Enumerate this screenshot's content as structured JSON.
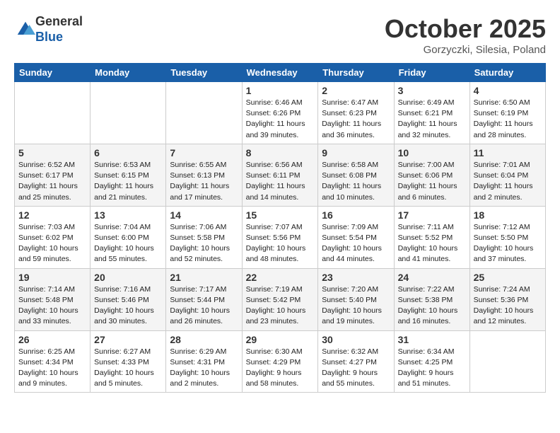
{
  "header": {
    "logo_line1": "General",
    "logo_line2": "Blue",
    "month_title": "October 2025",
    "location": "Gorzyczki, Silesia, Poland"
  },
  "days_of_week": [
    "Sunday",
    "Monday",
    "Tuesday",
    "Wednesday",
    "Thursday",
    "Friday",
    "Saturday"
  ],
  "weeks": [
    [
      {
        "day": "",
        "info": ""
      },
      {
        "day": "",
        "info": ""
      },
      {
        "day": "",
        "info": ""
      },
      {
        "day": "1",
        "info": "Sunrise: 6:46 AM\nSunset: 6:26 PM\nDaylight: 11 hours\nand 39 minutes."
      },
      {
        "day": "2",
        "info": "Sunrise: 6:47 AM\nSunset: 6:23 PM\nDaylight: 11 hours\nand 36 minutes."
      },
      {
        "day": "3",
        "info": "Sunrise: 6:49 AM\nSunset: 6:21 PM\nDaylight: 11 hours\nand 32 minutes."
      },
      {
        "day": "4",
        "info": "Sunrise: 6:50 AM\nSunset: 6:19 PM\nDaylight: 11 hours\nand 28 minutes."
      }
    ],
    [
      {
        "day": "5",
        "info": "Sunrise: 6:52 AM\nSunset: 6:17 PM\nDaylight: 11 hours\nand 25 minutes."
      },
      {
        "day": "6",
        "info": "Sunrise: 6:53 AM\nSunset: 6:15 PM\nDaylight: 11 hours\nand 21 minutes."
      },
      {
        "day": "7",
        "info": "Sunrise: 6:55 AM\nSunset: 6:13 PM\nDaylight: 11 hours\nand 17 minutes."
      },
      {
        "day": "8",
        "info": "Sunrise: 6:56 AM\nSunset: 6:11 PM\nDaylight: 11 hours\nand 14 minutes."
      },
      {
        "day": "9",
        "info": "Sunrise: 6:58 AM\nSunset: 6:08 PM\nDaylight: 11 hours\nand 10 minutes."
      },
      {
        "day": "10",
        "info": "Sunrise: 7:00 AM\nSunset: 6:06 PM\nDaylight: 11 hours\nand 6 minutes."
      },
      {
        "day": "11",
        "info": "Sunrise: 7:01 AM\nSunset: 6:04 PM\nDaylight: 11 hours\nand 2 minutes."
      }
    ],
    [
      {
        "day": "12",
        "info": "Sunrise: 7:03 AM\nSunset: 6:02 PM\nDaylight: 10 hours\nand 59 minutes."
      },
      {
        "day": "13",
        "info": "Sunrise: 7:04 AM\nSunset: 6:00 PM\nDaylight: 10 hours\nand 55 minutes."
      },
      {
        "day": "14",
        "info": "Sunrise: 7:06 AM\nSunset: 5:58 PM\nDaylight: 10 hours\nand 52 minutes."
      },
      {
        "day": "15",
        "info": "Sunrise: 7:07 AM\nSunset: 5:56 PM\nDaylight: 10 hours\nand 48 minutes."
      },
      {
        "day": "16",
        "info": "Sunrise: 7:09 AM\nSunset: 5:54 PM\nDaylight: 10 hours\nand 44 minutes."
      },
      {
        "day": "17",
        "info": "Sunrise: 7:11 AM\nSunset: 5:52 PM\nDaylight: 10 hours\nand 41 minutes."
      },
      {
        "day": "18",
        "info": "Sunrise: 7:12 AM\nSunset: 5:50 PM\nDaylight: 10 hours\nand 37 minutes."
      }
    ],
    [
      {
        "day": "19",
        "info": "Sunrise: 7:14 AM\nSunset: 5:48 PM\nDaylight: 10 hours\nand 33 minutes."
      },
      {
        "day": "20",
        "info": "Sunrise: 7:16 AM\nSunset: 5:46 PM\nDaylight: 10 hours\nand 30 minutes."
      },
      {
        "day": "21",
        "info": "Sunrise: 7:17 AM\nSunset: 5:44 PM\nDaylight: 10 hours\nand 26 minutes."
      },
      {
        "day": "22",
        "info": "Sunrise: 7:19 AM\nSunset: 5:42 PM\nDaylight: 10 hours\nand 23 minutes."
      },
      {
        "day": "23",
        "info": "Sunrise: 7:20 AM\nSunset: 5:40 PM\nDaylight: 10 hours\nand 19 minutes."
      },
      {
        "day": "24",
        "info": "Sunrise: 7:22 AM\nSunset: 5:38 PM\nDaylight: 10 hours\nand 16 minutes."
      },
      {
        "day": "25",
        "info": "Sunrise: 7:24 AM\nSunset: 5:36 PM\nDaylight: 10 hours\nand 12 minutes."
      }
    ],
    [
      {
        "day": "26",
        "info": "Sunrise: 6:25 AM\nSunset: 4:34 PM\nDaylight: 10 hours\nand 9 minutes."
      },
      {
        "day": "27",
        "info": "Sunrise: 6:27 AM\nSunset: 4:33 PM\nDaylight: 10 hours\nand 5 minutes."
      },
      {
        "day": "28",
        "info": "Sunrise: 6:29 AM\nSunset: 4:31 PM\nDaylight: 10 hours\nand 2 minutes."
      },
      {
        "day": "29",
        "info": "Sunrise: 6:30 AM\nSunset: 4:29 PM\nDaylight: 9 hours\nand 58 minutes."
      },
      {
        "day": "30",
        "info": "Sunrise: 6:32 AM\nSunset: 4:27 PM\nDaylight: 9 hours\nand 55 minutes."
      },
      {
        "day": "31",
        "info": "Sunrise: 6:34 AM\nSunset: 4:25 PM\nDaylight: 9 hours\nand 51 minutes."
      },
      {
        "day": "",
        "info": ""
      }
    ]
  ]
}
